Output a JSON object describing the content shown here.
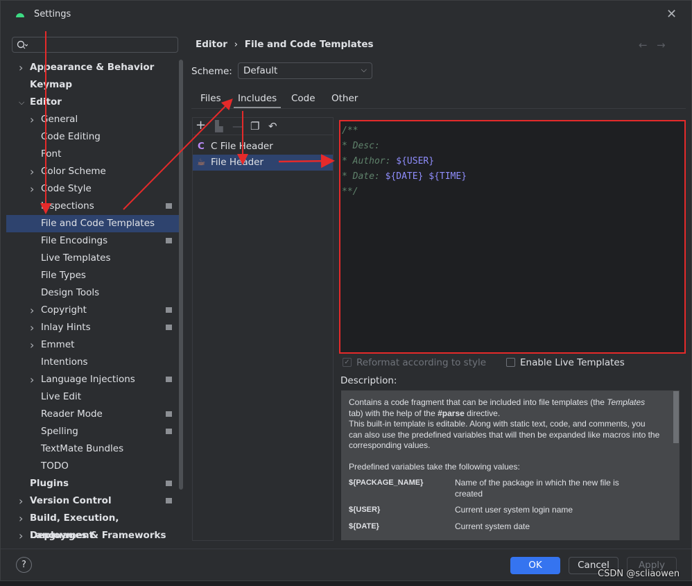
{
  "window": {
    "title": "Settings",
    "close_icon": "close-icon"
  },
  "search": {
    "placeholder": "Q"
  },
  "tree": [
    {
      "label": "Appearance & Behavior",
      "level": 0,
      "arrow": true
    },
    {
      "label": "Keymap",
      "level": 0
    },
    {
      "label": "Editor",
      "level": 0,
      "arrow": true,
      "expanded": true
    },
    {
      "label": "General",
      "level": 1,
      "arrow": true
    },
    {
      "label": "Code Editing",
      "level": 1
    },
    {
      "label": "Font",
      "level": 1
    },
    {
      "label": "Color Scheme",
      "level": 1,
      "arrow": true
    },
    {
      "label": "Code Style",
      "level": 1,
      "arrow": true
    },
    {
      "label": "Inspections",
      "level": 1,
      "badge": true
    },
    {
      "label": "File and Code Templates",
      "level": 1,
      "selected": true
    },
    {
      "label": "File Encodings",
      "level": 1,
      "badge": true
    },
    {
      "label": "Live Templates",
      "level": 1
    },
    {
      "label": "File Types",
      "level": 1
    },
    {
      "label": "Design Tools",
      "level": 1
    },
    {
      "label": "Copyright",
      "level": 1,
      "arrow": true,
      "badge": true
    },
    {
      "label": "Inlay Hints",
      "level": 1,
      "arrow": true,
      "badge": true
    },
    {
      "label": "Emmet",
      "level": 1,
      "arrow": true
    },
    {
      "label": "Intentions",
      "level": 1
    },
    {
      "label": "Language Injections",
      "level": 1,
      "arrow": true,
      "badge": true
    },
    {
      "label": "Live Edit",
      "level": 1
    },
    {
      "label": "Reader Mode",
      "level": 1,
      "badge": true
    },
    {
      "label": "Spelling",
      "level": 1,
      "badge": true
    },
    {
      "label": "TextMate Bundles",
      "level": 1
    },
    {
      "label": "TODO",
      "level": 1
    },
    {
      "label": "Plugins",
      "level": 0,
      "badge": true
    },
    {
      "label": "Version Control",
      "level": 0,
      "arrow": true,
      "badge": true
    },
    {
      "label": "Build, Execution, Deployment",
      "level": 0,
      "arrow": true
    },
    {
      "label": "Languages & Frameworks",
      "level": 0,
      "arrow": true
    }
  ],
  "breadcrumb": {
    "parent": "Editor",
    "sep": "›",
    "current": "File and Code Templates"
  },
  "scheme": {
    "label": "Scheme:",
    "value": "Default"
  },
  "tabs": [
    {
      "label": "Files"
    },
    {
      "label": "Includes",
      "active": true
    },
    {
      "label": "Code"
    },
    {
      "label": "Other"
    }
  ],
  "templates": [
    {
      "label": "C File Header",
      "icon": "c-file-icon"
    },
    {
      "label": "File Header",
      "icon": "java-cup-icon",
      "selected": true
    }
  ],
  "editor": {
    "l1": "/**",
    "l2": "* Desc:",
    "l3a": "* Author: ",
    "l3b": "${USER}",
    "l4a": "* Date: ",
    "l4b": "${DATE}",
    "l4c": "${TIME}",
    "l5": "**/"
  },
  "options": {
    "reformat": "Reformat according to style",
    "reformat_checked": true,
    "live": "Enable Live Templates",
    "live_checked": false
  },
  "description": {
    "label": "Description:",
    "p1a": "Contains a code fragment that can be included into file templates (the ",
    "p1b": "Templates",
    "p1c": " tab) with the help of the ",
    "p1d": "#parse",
    "p1e": " directive.",
    "p2": "This built-in template is editable. Along with static text, code, and comments, you can also use the predefined variables that will then be expanded like macros into the corresponding values.",
    "p3": "Predefined variables take the following values:",
    "vars": [
      {
        "name": "${PACKAGE_NAME}",
        "desc": "Name of the package in which the new file is created"
      },
      {
        "name": "${USER}",
        "desc": "Current user system login name"
      },
      {
        "name": "${DATE}",
        "desc": "Current system date"
      }
    ]
  },
  "buttons": {
    "ok": "OK",
    "cancel": "Cancel",
    "apply": "Apply",
    "help": "?"
  },
  "watermark": "CSDN @scliaowen",
  "colors": {
    "accent": "#3574f0",
    "selection": "#2e436e",
    "annotation": "#e52a2a"
  }
}
